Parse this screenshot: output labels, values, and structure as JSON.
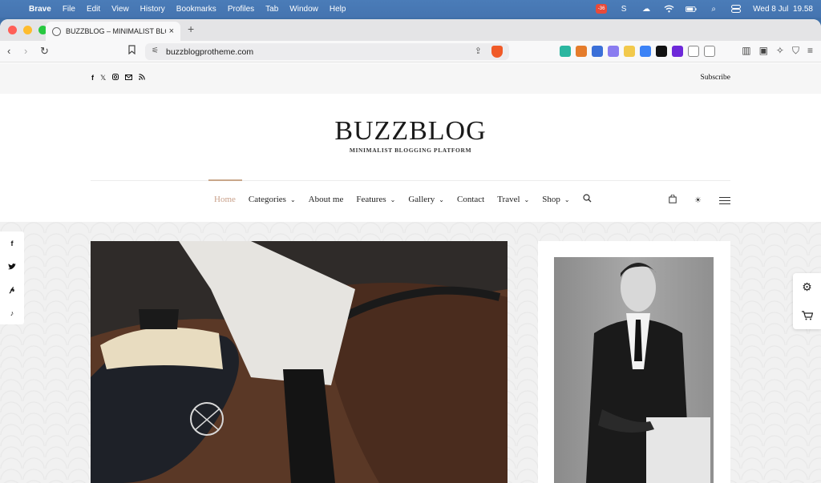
{
  "menubar": {
    "apple": "",
    "items": [
      "Brave",
      "File",
      "Edit",
      "View",
      "History",
      "Bookmarks",
      "Profiles",
      "Tab",
      "Window",
      "Help"
    ],
    "battery_badge": "-36",
    "clock": "Wed 8 Jul  19.58"
  },
  "browser": {
    "tab_title": "BUZZBLOG – MINIMALIST BLOG",
    "tab_close": "×",
    "new_tab": "+",
    "url": "buzzblogprotheme.com",
    "traffic_colors": [
      "#ff5f57",
      "#febc2e",
      "#28c840"
    ],
    "extension_colors": [
      "#2bb6a0",
      "#e57c2b",
      "#3a6fd8",
      "#8a7cf0",
      "#f2c94c",
      "#3b82f6",
      "#111111",
      "#6d28d9"
    ]
  },
  "site": {
    "subscribe": "Subscribe",
    "logo": "BUZZBLOG",
    "tagline": "MINIMALIST BLOGGING PLATFORM",
    "accent": "#c9a08a",
    "nav": [
      {
        "label": "Home",
        "active": true,
        "dropdown": false
      },
      {
        "label": "Categories",
        "active": false,
        "dropdown": true
      },
      {
        "label": "About me",
        "active": false,
        "dropdown": false
      },
      {
        "label": "Features",
        "active": false,
        "dropdown": true
      },
      {
        "label": "Gallery",
        "active": false,
        "dropdown": true
      },
      {
        "label": "Contact",
        "active": false,
        "dropdown": false
      },
      {
        "label": "Travel",
        "active": false,
        "dropdown": true
      },
      {
        "label": "Shop",
        "active": false,
        "dropdown": true
      }
    ],
    "social_top": [
      "facebook-icon",
      "x-icon",
      "instagram-icon",
      "email-icon",
      "rss-icon"
    ],
    "share_side": [
      "facebook-icon",
      "twitter-icon",
      "pinterest-icon",
      "tiktok-icon"
    ],
    "tools_side": [
      "settings-gear-icon",
      "cart-icon"
    ]
  }
}
